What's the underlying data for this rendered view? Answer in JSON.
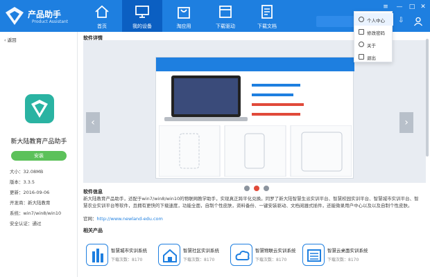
{
  "app": {
    "brand_cn": "产品助手",
    "brand_en": "Product Assistant"
  },
  "nav": [
    {
      "label": "首页"
    },
    {
      "label": "我的设备"
    },
    {
      "label": "淘应用"
    },
    {
      "label": "下载驱动"
    },
    {
      "label": "下载文档"
    }
  ],
  "menu": {
    "items": [
      {
        "label": "个人中心"
      },
      {
        "label": "修改密码"
      },
      {
        "label": "关于"
      },
      {
        "label": "退出"
      }
    ]
  },
  "left": {
    "back_label": "返回",
    "app_name": "新大陆教育产品助手",
    "install_label": "安装",
    "meta": [
      "大小：32.08MB",
      "版本：3.3.5",
      "更新：2016-09-06",
      "开发商：新大陆教育",
      "系统：win7/win8/win10",
      "安全认证：通过"
    ]
  },
  "main": {
    "detail_title": "软件详情",
    "info_title": "软件信息",
    "description": "新大陆教育产品助手，适配于win7/win8/win10的物联网教学助手，实现真正跨平化兑换。同罗了新大陆智慧生派实训平台、智慧校园实训平台、智慧城市实训平台、智慧农业实训平台等软件，且拥有更快的下载速度，功能全面，自制个性皮肤，资料备份、一键安装驱动、文档阅器式插件，还能微录用户中心以及以及自制个性皮肤。",
    "url_prefix": "官网：",
    "url": "http://www.newland-edu.com",
    "related_title": "相关产品",
    "related": [
      {
        "name": "智慧城市实训系统",
        "downloads": "下载次数：8170"
      },
      {
        "name": "智慧社区实训系统",
        "downloads": "下载次数：8170"
      },
      {
        "name": "智慧物联云实训系统",
        "downloads": "下载次数：8170"
      },
      {
        "name": "智慧云桌面实训系统",
        "downloads": "下载次数：8170"
      }
    ]
  },
  "colors": {
    "primary": "#1e7fe0",
    "active_tab": "#0b5fc2",
    "install": "#5cc15a",
    "dot_active": "#e04a3a",
    "dot": "#8c949e"
  }
}
